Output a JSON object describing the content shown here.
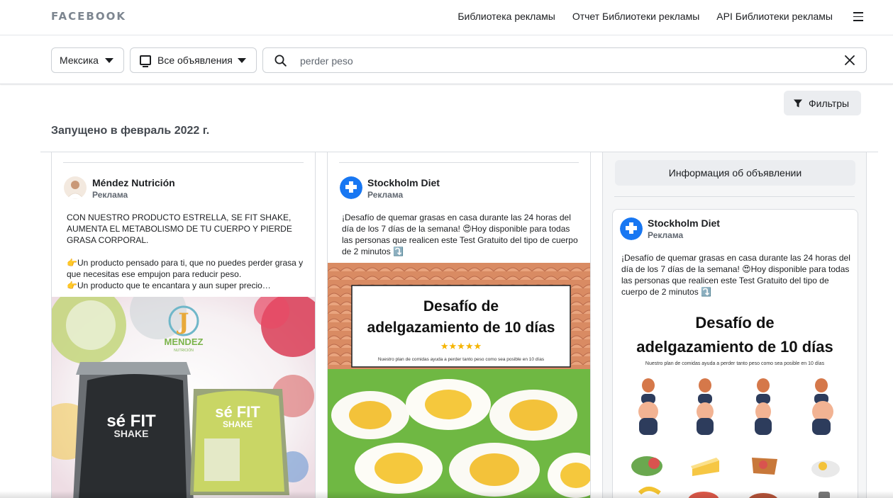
{
  "header": {
    "logo": "FACEBOOK",
    "nav": [
      "Библиотека рекламы",
      "Отчет Библиотеки рекламы",
      "API Библиотеки рекламы"
    ],
    "menu_icon": "hamburger-icon"
  },
  "search": {
    "country": "Мексика",
    "ad_type": "Все объявления",
    "query": "perder peso",
    "search_icon": "search-icon",
    "clear_icon": "close-icon"
  },
  "filters": {
    "label": "Фильтры",
    "icon": "funnel-icon"
  },
  "launched_heading": "Запущено в февраль 2022 г.",
  "ads": [
    {
      "advertiser": "Méndez Nutrición",
      "sponsored": "Реклама",
      "text": "CON NUESTRO PRODUCTO ESTRELLA, SE FIT SHAKE, AUMENTA EL METABOLISMO DE TU CUERPO Y PIERDE GRASA CORPORAL.\n\n👉Un producto pensado para ti, que no puedes perder grasa y que necesitas ese empujon para reducir peso.\n👉Un producto que te encantara y aun super precio…",
      "creative": {
        "brand_letter": "J",
        "brand_name": "MENDEZ",
        "brand_sub": "NUTRICIÓN",
        "bag_brand_1": "sé FIT",
        "bag_brand_2": "SHAKE"
      }
    },
    {
      "advertiser": "Stockholm Diet",
      "sponsored": "Реклама",
      "text": "¡Desafío de quemar grasas en casa durante las 24 horas del día de los 7 días de la semana! 😍Hoy disponible para todas las personas que realicen este Test Gratuito del tipo de cuerpo de 2 minutos ⤵️",
      "creative": {
        "title_line1": "Desafío de",
        "title_line2": "adelgazamiento de 10 días",
        "stars": "★★★★★",
        "subtitle": "Nuestro plan de comidas ayuda a perder tanto peso como sea posible en 10 días"
      }
    }
  ],
  "detail_panel": {
    "info_button": "Информация об объявлении",
    "advertiser": "Stockholm Diet",
    "sponsored": "Реклама",
    "text": "¡Desafío de quemar grasas en casa durante las 24 horas del día de los 7 días de la semana! 😍Hoy disponible para todas las personas que realicen este Test Gratuito del tipo de cuerpo de 2 minutos ⤵️",
    "creative": {
      "title_line1": "Desafío de",
      "title_line2": "adelgazamiento de 10 días",
      "subtitle": "Nuestro plan de comidas ayuda a perder tanto peso como sea posible en 10 días"
    }
  },
  "colors": {
    "logo_gray": "#7d8690",
    "border": "#dadde1",
    "button_bg": "#ebedf0",
    "stockholm_blue": "#1877f2"
  }
}
